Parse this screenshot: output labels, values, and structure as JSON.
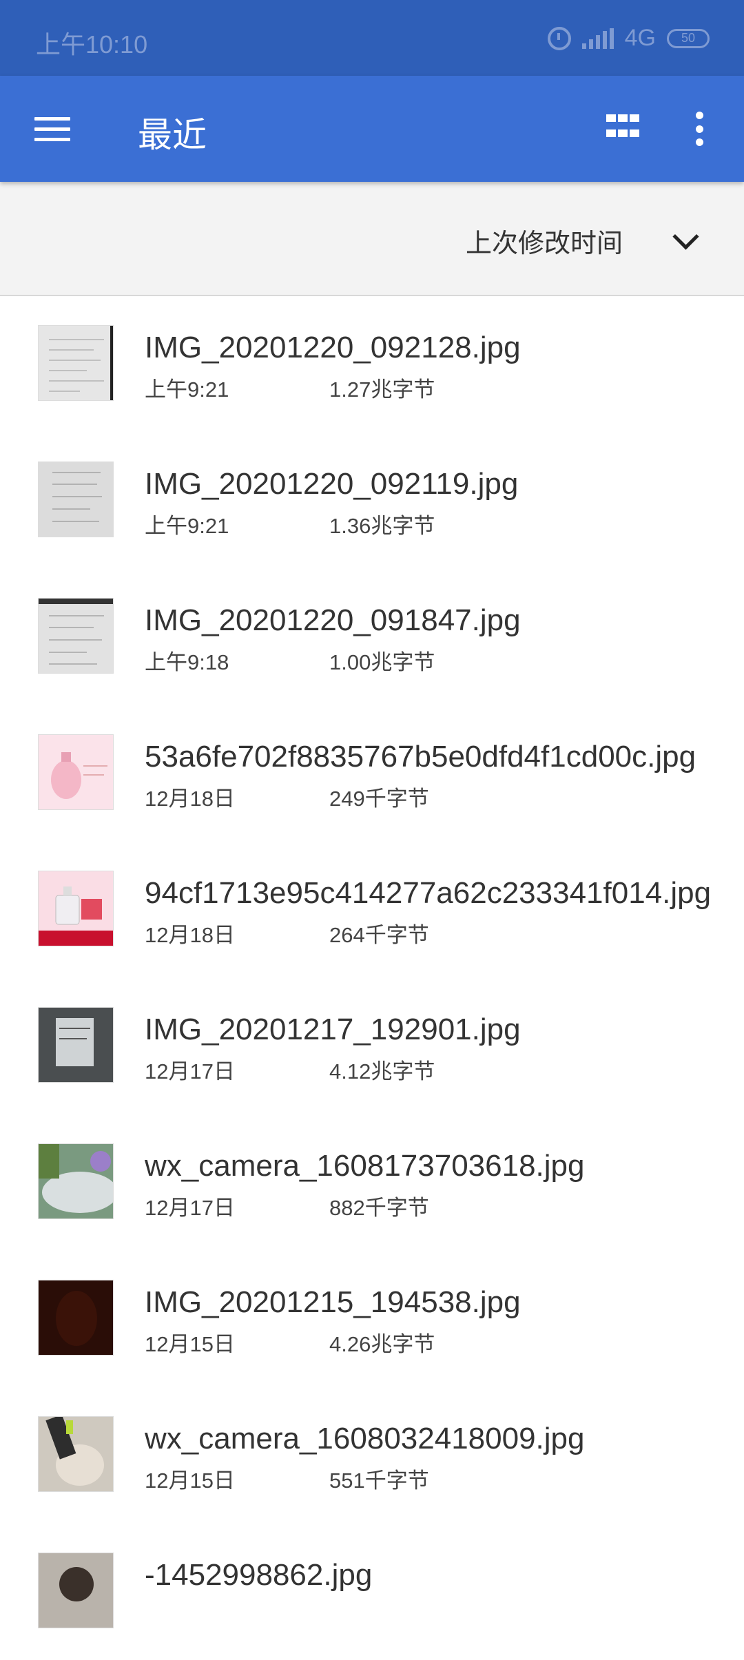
{
  "status_bar": {
    "time": "上午10:10",
    "network": "4G",
    "battery": "50",
    "icons": [
      "alarm-icon",
      "signal-icon",
      "battery-icon"
    ]
  },
  "app_bar": {
    "title": "最近",
    "icons": [
      "menu-icon",
      "grid-view-icon",
      "more-vert-icon"
    ],
    "color": "#3b6fd4"
  },
  "sort_bar": {
    "label": "上次修改时间",
    "icon": "chevron-down-icon"
  },
  "files": [
    {
      "name": "IMG_20201220_092128.jpg",
      "date": "上午9:21",
      "size": "1.27兆字节"
    },
    {
      "name": "IMG_20201220_092119.jpg",
      "date": "上午9:21",
      "size": "1.36兆字节"
    },
    {
      "name": "IMG_20201220_091847.jpg",
      "date": "上午9:18",
      "size": "1.00兆字节"
    },
    {
      "name": "53a6fe702f8835767b5e0dfd4f1cd00c.jpg",
      "date": "12月18日",
      "size": "249千字节"
    },
    {
      "name": "94cf1713e95c414277a62c233341f014.jpg",
      "date": "12月18日",
      "size": "264千字节"
    },
    {
      "name": "IMG_20201217_192901.jpg",
      "date": "12月17日",
      "size": "4.12兆字节"
    },
    {
      "name": "wx_camera_1608173703618.jpg",
      "date": "12月17日",
      "size": "882千字节"
    },
    {
      "name": "IMG_20201215_194538.jpg",
      "date": "12月15日",
      "size": "4.26兆字节"
    },
    {
      "name": "wx_camera_1608032418009.jpg",
      "date": "12月15日",
      "size": "551千字节"
    },
    {
      "name": "-1452998862.jpg",
      "date": "",
      "size": ""
    }
  ]
}
